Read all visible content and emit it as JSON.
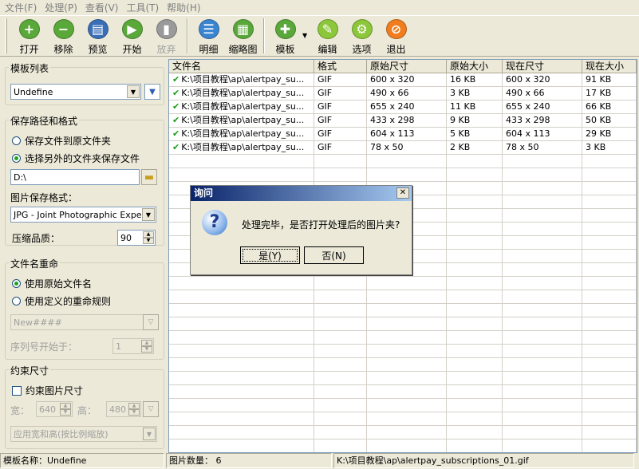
{
  "menu": [
    "文件(F)",
    "处理(P)",
    "查看(V)",
    "工具(T)",
    "帮助(H)"
  ],
  "toolbar": {
    "open": "打开",
    "remove": "移除",
    "preview": "预览",
    "start": "开始",
    "abandon": "放弃",
    "detail": "明细",
    "thumbnail": "缩略图",
    "template": "模板",
    "edit": "编辑",
    "options": "选项",
    "exit": "退出"
  },
  "left": {
    "template_group": "模板列表",
    "template_value": "Undefine",
    "save_group": "保存路径和格式",
    "save_original": "保存文件到原文件夹",
    "save_other": "选择另外的文件夹保存文件",
    "path_value": "D:\\",
    "format_label": "图片保存格式：",
    "format_value": "JPG - Joint Photographic Experts Group",
    "quality_label": "压缩品质：",
    "quality_value": "90",
    "rename_group": "文件名重命",
    "rename_original": "使用原始文件名",
    "rename_custom": "使用定义的重命规则",
    "pattern_value": "New####",
    "serial_label": "序列号开始于：",
    "serial_value": "1",
    "constrain_group": "约束尺寸",
    "constrain_check": "约束图片尺寸",
    "width_label": "宽：",
    "width_value": "640",
    "height_label": "高：",
    "height_value": "480",
    "scale_value": "应用宽和高(按比例缩放)"
  },
  "grid": {
    "headers": [
      "文件名",
      "格式",
      "原始尺寸",
      "原始大小",
      "现在尺寸",
      "现在大小"
    ],
    "rows": [
      [
        "K:\\项目教程\\ap\\alertpay_su...",
        "GIF",
        "600 x 320",
        "16 KB",
        "600 x 320",
        "91 KB"
      ],
      [
        "K:\\项目教程\\ap\\alertpay_su...",
        "GIF",
        "490 x 66",
        "3 KB",
        "490 x 66",
        "17 KB"
      ],
      [
        "K:\\项目教程\\ap\\alertpay_su...",
        "GIF",
        "655 x 240",
        "11 KB",
        "655 x 240",
        "66 KB"
      ],
      [
        "K:\\项目教程\\ap\\alertpay_su...",
        "GIF",
        "433 x 298",
        "9 KB",
        "433 x 298",
        "50 KB"
      ],
      [
        "K:\\项目教程\\ap\\alertpay_su...",
        "GIF",
        "604 x 113",
        "5 KB",
        "604 x 113",
        "29 KB"
      ],
      [
        "K:\\项目教程\\ap\\alertpay_su...",
        "GIF",
        "78 x 50",
        "2 KB",
        "78 x 50",
        "3 KB"
      ]
    ]
  },
  "dialog": {
    "title": "询问",
    "message": "处理完毕，是否打开处理后的图片夹?",
    "yes": "是(Y)",
    "no": "否(N)"
  },
  "status": {
    "template": "模板名称：Undefine",
    "count": "图片数量： 6",
    "file": "K:\\项目教程\\ap\\alertpay_subscriptions_01.gif"
  }
}
